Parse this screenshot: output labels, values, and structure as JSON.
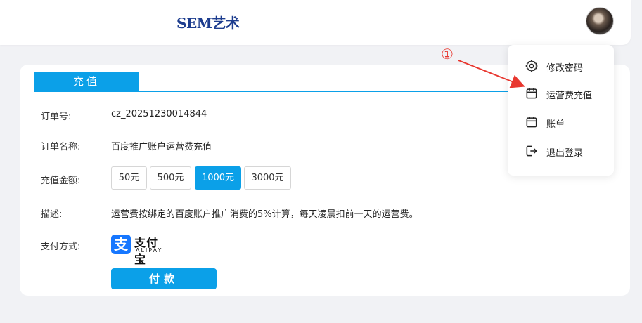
{
  "header": {
    "brand": "SEM艺术",
    "avatar_icon": "user-avatar"
  },
  "tab": {
    "label": "充值"
  },
  "form": {
    "order_no_label": "订单号:",
    "order_no_value": "cz_20251230014844",
    "order_name_label": "订单名称:",
    "order_name_value": "百度推广账户运营费充值",
    "amount_label": "充值金额:",
    "amount_options": [
      {
        "label": "50元",
        "selected": false
      },
      {
        "label": "500元",
        "selected": false
      },
      {
        "label": "1000元",
        "selected": true
      },
      {
        "label": "3000元",
        "selected": false
      }
    ],
    "description_label": "描述:",
    "description_value": "运营费按绑定的百度账户推广消费的5%计算，每天凌晨扣前一天的运营费。",
    "payment_label": "支付方式:",
    "payment_method": {
      "icon": "alipay-logo",
      "name_cn": "支付宝",
      "name_en": "ALIPAY"
    },
    "pay_button": "付款"
  },
  "dropdown": {
    "items": [
      {
        "label": "修改密码",
        "icon": "gear-icon"
      },
      {
        "label": "运营费充值",
        "icon": "calendar-icon"
      },
      {
        "label": "账单",
        "icon": "calendar-icon"
      },
      {
        "label": "退出登录",
        "icon": "logout-icon"
      }
    ]
  },
  "annotation": {
    "marker": "①",
    "color": "#e8372f"
  },
  "colors": {
    "accent": "#0ba0e8",
    "brand": "#1d3d8f",
    "alipay": "#1677ff"
  }
}
